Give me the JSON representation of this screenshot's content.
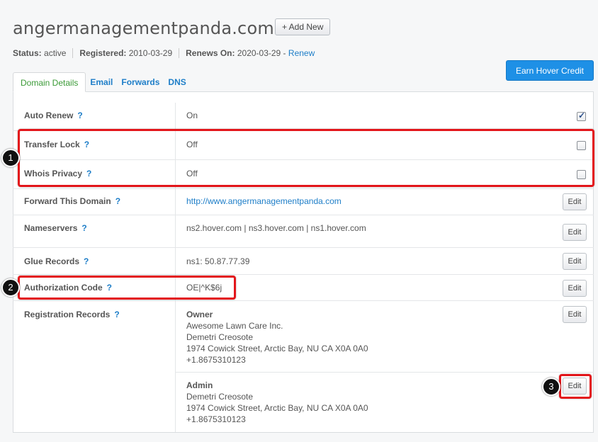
{
  "domain": "angermanagementpanda.com",
  "add_new_label": "+ Add New",
  "status": {
    "status_label": "Status:",
    "status_value": "active",
    "registered_label": "Registered:",
    "registered_value": "2010-03-29",
    "renews_label": "Renews On:",
    "renews_value": "2020-03-29 -",
    "renew_link": "Renew"
  },
  "earn_button": "Earn Hover Credit",
  "tabs": [
    {
      "label": "Domain Details",
      "active": true
    },
    {
      "label": "Email",
      "active": false
    },
    {
      "label": "Forwards",
      "active": false
    },
    {
      "label": "DNS",
      "active": false
    }
  ],
  "rows": {
    "auto_renew": {
      "label": "Auto Renew",
      "q": "?",
      "value": "On",
      "checked": true
    },
    "transfer_lock": {
      "label": "Transfer Lock",
      "q": "?",
      "value": "Off",
      "checked": false
    },
    "whois_privacy": {
      "label": "Whois Privacy",
      "q": "?",
      "value": "Off",
      "checked": false
    },
    "forward": {
      "label": "Forward This Domain",
      "q": "?",
      "value": "http://www.angermanagementpanda.com",
      "edit": "Edit"
    },
    "nameservers": {
      "label": "Nameservers",
      "q": "?",
      "value": "ns2.hover.com | ns3.hover.com | ns1.hover.com",
      "edit": "Edit"
    },
    "glue": {
      "label": "Glue Records",
      "q": "?",
      "value": "ns1: 50.87.77.39",
      "edit": "Edit"
    },
    "auth": {
      "label": "Authorization Code",
      "q": "?",
      "value": "OE|^K$6j",
      "edit": "Edit"
    },
    "registration": {
      "label": "Registration Records",
      "q": "?",
      "owner": {
        "title": "Owner",
        "line1": "Awesome Lawn Care Inc.",
        "line2": "Demetri Creosote",
        "line3": "1974 Cowick Street, Arctic Bay, NU CA X0A 0A0",
        "line4": "+1.8675310123",
        "edit": "Edit"
      },
      "admin": {
        "title": "Admin",
        "line1": "Demetri Creosote",
        "line2": "1974 Cowick Street, Arctic Bay, NU CA X0A 0A0",
        "line3": "+1.8675310123",
        "edit": "Edit"
      }
    }
  },
  "annotations": {
    "badge1": "1",
    "badge2": "2",
    "badge3": "3"
  },
  "colors": {
    "link": "#1e7ec8",
    "active_tab": "#3a9a36",
    "highlight": "#e3161b",
    "button": "#1e90e6"
  }
}
